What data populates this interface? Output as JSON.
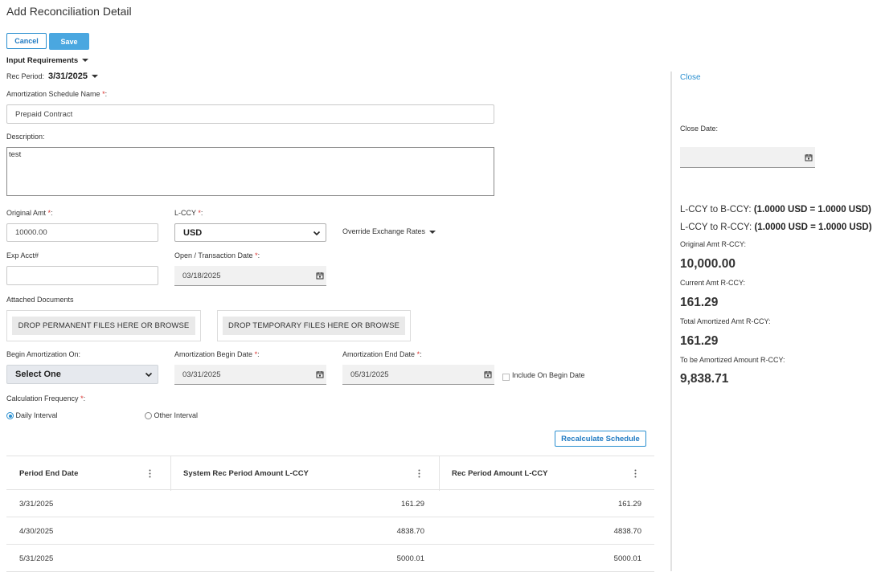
{
  "page": {
    "title": "Add Reconciliation Detail"
  },
  "toolbar": {
    "cancel_label": "Cancel",
    "save_label": "Save"
  },
  "section": {
    "input_requirements_label": "Input Requirements"
  },
  "rec_period": {
    "label": "Rec Period:",
    "value": "3/31/2025"
  },
  "form": {
    "required_mark": "*",
    "schedule_name": {
      "label": "Amortization Schedule Name",
      "value": "Prepaid Contract"
    },
    "description": {
      "label": "Description:",
      "value": "test"
    },
    "original_amt": {
      "label": "Original Amt",
      "value": "10000.00"
    },
    "lccy": {
      "label": "L-CCY",
      "value": "USD"
    },
    "override_rates_label": "Override Exchange Rates",
    "exp_acct": {
      "label": "Exp Acct#",
      "value": ""
    },
    "open_date": {
      "label": "Open / Transaction Date",
      "value": "03/18/2025"
    },
    "attached_documents_label": "Attached Documents",
    "drop_permanent_label": "DROP PERMANENT FILES HERE OR BROWSE",
    "drop_temporary_label": "DROP TEMPORARY FILES HERE OR BROWSE",
    "begin_on": {
      "label": "Begin Amortization On:",
      "value": "Select One"
    },
    "begin_date": {
      "label": "Amortization Begin Date",
      "value": "03/31/2025"
    },
    "end_date": {
      "label": "Amortization End Date",
      "value": "05/31/2025"
    },
    "include_begin_label": "Include On Begin Date",
    "include_begin_checked": false,
    "calc_frequency": {
      "label": "Calculation Frequency",
      "options": [
        "Daily Interval",
        "Other Interval"
      ],
      "selected": "Daily Interval"
    },
    "recalc_label": "Recalculate Schedule"
  },
  "table": {
    "columns": [
      "Period End Date",
      "System Rec Period Amount L-CCY",
      "Rec Period Amount L-CCY"
    ],
    "rows": [
      [
        "3/31/2025",
        "161.29",
        "161.29"
      ],
      [
        "4/30/2025",
        "4838.70",
        "4838.70"
      ],
      [
        "5/31/2025",
        "5000.01",
        "5000.01"
      ]
    ]
  },
  "sidebar": {
    "close_label": "Close",
    "close_date_label": "Close Date:",
    "close_date_value": "",
    "rate_b_label": "L-CCY to B-CCY:",
    "rate_b_value": "(1.0000 USD = 1.0000 USD)",
    "rate_r_label": "L-CCY to R-CCY:",
    "rate_r_value": "(1.0000 USD = 1.0000 USD)",
    "original_amt_label": "Original Amt R-CCY:",
    "original_amt_value": "10,000.00",
    "current_amt_label": "Current Amt R-CCY:",
    "current_amt_value": "161.29",
    "total_amortized_label": "Total Amortized Amt R-CCY:",
    "total_amortized_value": "161.29",
    "to_be_amortized_label": "To be Amortized Amount R-CCY:",
    "to_be_amortized_value": "9,838.71"
  },
  "colors": {
    "accent": "#2a8fd0",
    "save_button": "#4aa7e0",
    "required": "#d9302c"
  }
}
